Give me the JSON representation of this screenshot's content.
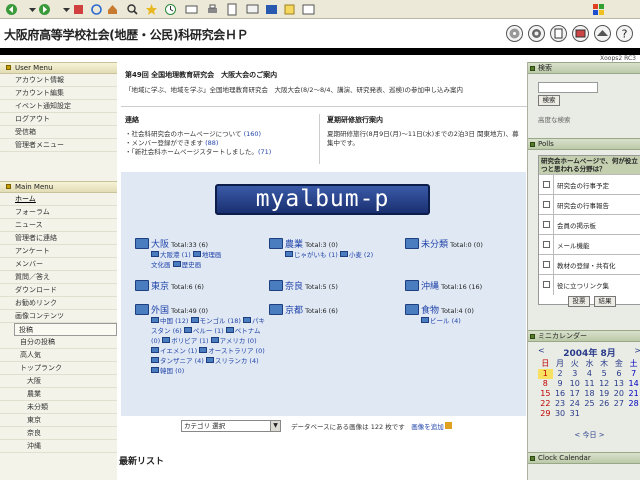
{
  "toolbar": {
    "icons": [
      "back-icon",
      "forward-icon",
      "stop-icon",
      "refresh-icon",
      "home-icon",
      "search-icon",
      "favorites-icon",
      "history-icon",
      "mail-icon",
      "print-icon",
      "edit-icon",
      "discuss-icon",
      "messenger-icon",
      "windows-flag-icon"
    ]
  },
  "header": {
    "site_title": "大阪府高等学校社会(地歴・公民)科研究会ＨＰ",
    "icons": [
      "cd-icon",
      "gear-icon",
      "note-icon",
      "scroll-icon",
      "hat-icon",
      "help-icon"
    ],
    "version": "Xoops2 RC3"
  },
  "left": {
    "user_menu_title": "User Menu",
    "user_menu": [
      "アカウント情報",
      "アカウント編集",
      "イベント通知設定",
      "ログアウト",
      "受信箱",
      "管理者メニュー"
    ],
    "main_menu_title": "Main Menu",
    "main_menu": [
      "ホーム",
      "フォーラム",
      "ニュース",
      "管理者に連絡",
      "アンケート",
      "メンバー",
      "質問／答え",
      "ダウンロード",
      "お勧めリンク",
      "画像コンテンツ",
      "投稿",
      "自分の投稿",
      "高人気",
      "トップランク",
      "大阪",
      "農業",
      "未分類",
      "東京",
      "奈良",
      "沖縄"
    ]
  },
  "center": {
    "notice1_title": "第49回 全国地理教育研究会　大阪大会のご案内",
    "notice1_text": "「地域に学ぶ、地域を学ぶ」全国地理教育研究会　大阪大会(8/2～8/4、講演、研究発表、巡検)の参加申し込み案内",
    "notice2_title": "連絡",
    "notice2_items": [
      "社会科研究会のホームページについて",
      "メンバー登録ができます",
      "「新社会科ホームページスタートしました。"
    ],
    "notice2_counts": [
      "(160)",
      "(88)",
      "(71)"
    ],
    "notice3_title": "夏期研修旅行案内",
    "notice3_text": "夏期研修旅行(8月9日(月)～11日(水)までの2泊3日 関東地方)、募集中です。",
    "album_logo": "myalbum-p",
    "categories": [
      {
        "name": "大阪",
        "total": "Total:33 (6)",
        "subs": [
          "大阪港 (1)",
          "地理画",
          "文化画",
          "歴史画"
        ]
      },
      {
        "name": "農業",
        "total": "Total:3 (0)",
        "subs": [
          "じゃがいも (1)",
          "小麦 (2)"
        ]
      },
      {
        "name": "未分類",
        "total": "Total:0 (0)",
        "subs": []
      },
      {
        "name": "東京",
        "total": "Total:6 (6)",
        "subs": []
      },
      {
        "name": "奈良",
        "total": "Total:5 (5)",
        "subs": []
      },
      {
        "name": "沖縄",
        "total": "Total:16 (16)",
        "subs": []
      },
      {
        "name": "外国",
        "total": "Total:49 (0)",
        "subs": [
          "中国 (12)",
          "モンゴル (18)",
          "パキスタン (6)",
          "ペルー (1)",
          "ベトナム (0)",
          "ボリビア (1)",
          "アメリカ (0)",
          "イエメン (1)",
          "オーストラリア (0)",
          "タンザニア (4)",
          "スリランカ (4)",
          "韓国 (0)"
        ]
      },
      {
        "name": "京都",
        "total": "Total:6 (6)",
        "subs": []
      },
      {
        "name": "食物",
        "total": "Total:4 (0)",
        "subs": [
          "ビール (4)"
        ]
      }
    ],
    "category_select": "カテゴリ 選択",
    "db_info": "データベースにある画像は 122 枚です",
    "add_image": "画像を追加",
    "latest_title": "最新リスト"
  },
  "right": {
    "search_title": "検索",
    "search_button": "検索",
    "advanced_search": "高度な検索",
    "polls_title": "Polls",
    "poll_question": "研究会ホームページで、何が役立つと思われる分野は？",
    "poll_options": [
      "研究会の行事予定",
      "研究会の行事報告",
      "会員の掲示板",
      "メール機能",
      "教材の登録・共有化",
      "役に立つリンク集"
    ],
    "poll_vote": "投票",
    "poll_results": "結果",
    "mini_calendar_title": "ミニカレンダー",
    "calendar_month": "2004年 8月",
    "calendar_prev": "<",
    "calendar_next": ">",
    "weekdays": [
      "日",
      "月",
      "火",
      "水",
      "木",
      "金",
      "土"
    ],
    "weeks": [
      [
        "1",
        "2",
        "3",
        "4",
        "5",
        "6",
        "7"
      ],
      [
        "8",
        "9",
        "10",
        "11",
        "12",
        "13",
        "14"
      ],
      [
        "15",
        "16",
        "17",
        "18",
        "19",
        "20",
        "21"
      ],
      [
        "22",
        "23",
        "24",
        "25",
        "26",
        "27",
        "28"
      ],
      [
        "29",
        "30",
        "31",
        "",
        "",
        "",
        ""
      ]
    ],
    "today_link": "< 今日 >",
    "clock_title": "Clock Calendar"
  }
}
